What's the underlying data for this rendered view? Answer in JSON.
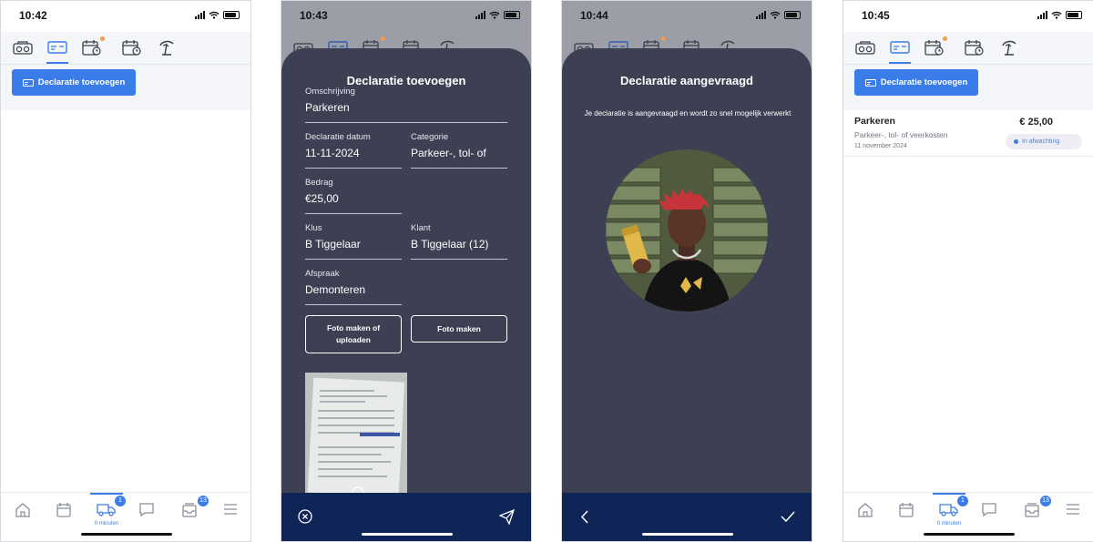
{
  "colors": {
    "accent": "#3b7de8",
    "sheet": "#3d3f52",
    "footer": "#0f2558",
    "notification_dot": "#f39b4b"
  },
  "screens": [
    {
      "time": "10:42"
    },
    {
      "time": "10:43"
    },
    {
      "time": "10:44"
    },
    {
      "time": "10:45"
    }
  ],
  "top_nav_icons": [
    "meter-icon",
    "expense-card-icon",
    "calendar-clock-icon",
    "calendar-time-icon",
    "vacation-icon"
  ],
  "bottom_nav": {
    "items": [
      "home-icon",
      "calendar-icon",
      "van-icon",
      "chat-icon",
      "inbox-icon",
      "menu-icon"
    ],
    "van_badge": "1",
    "minutes_label": "0 minuten",
    "inbox_badge": "13"
  },
  "add_button_label": "Declaratie toevoegen",
  "form": {
    "title": "Declaratie toevoegen",
    "fields": [
      {
        "label": "Omschrijving",
        "value": "Parkeren"
      },
      {
        "label": "Declaratie datum",
        "value": "11-11-2024"
      },
      {
        "label": "Categorie",
        "value": "Parkeer-, tol- of"
      },
      {
        "label": "Bedrag",
        "value": "€25,00"
      },
      {
        "label": "Klus",
        "value": "B Tiggelaar"
      },
      {
        "label": "Klant",
        "value": "B Tiggelaar (12)"
      },
      {
        "label": "Afspraak",
        "value": "Demonteren"
      }
    ],
    "photo_upload_label": "Foto maken of uploaden",
    "photo_label": "Foto maken"
  },
  "confirmation": {
    "title": "Declaratie aangevraagd",
    "message": "Je declaratie is aangevraagd en wordt zo snel mogelijk verwerkt"
  },
  "expense_item": {
    "title": "Parkeren",
    "category": "Parkeer-, tol- of veerkosten",
    "date": "11 november 2024",
    "amount": "€ 25,00",
    "status": "In afwachting"
  }
}
